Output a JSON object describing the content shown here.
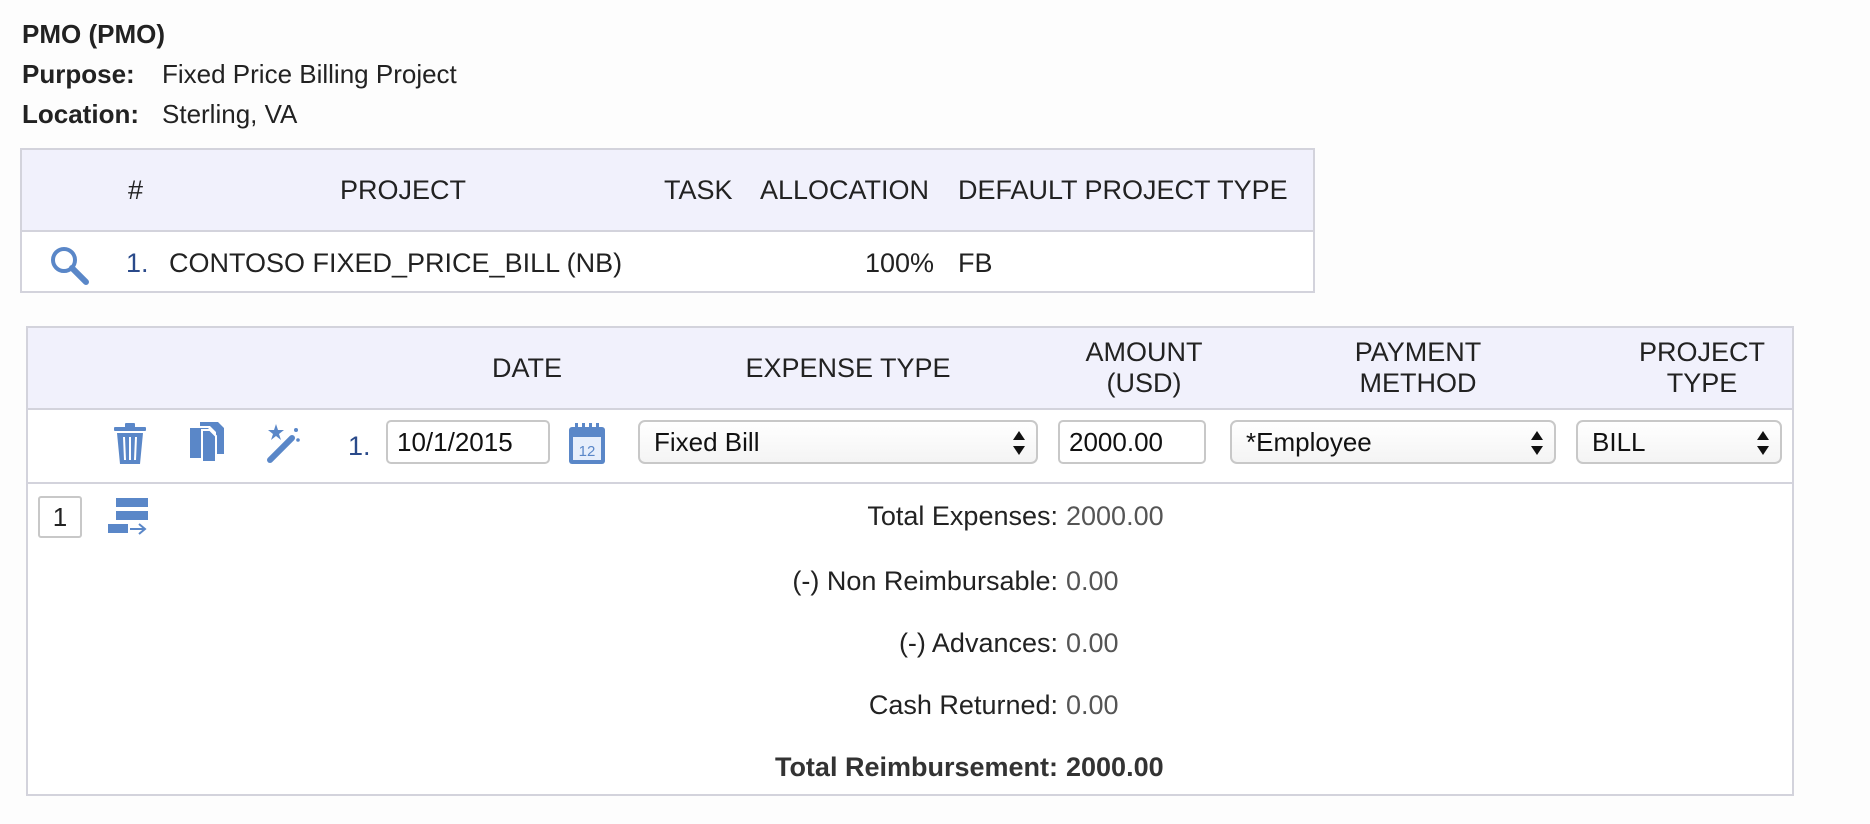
{
  "header": {
    "title": "PMO (PMO)",
    "purpose_label": "Purpose:",
    "purpose_value": "Fixed Price Billing Project",
    "location_label": "Location:",
    "location_value": "Sterling, VA"
  },
  "allocation": {
    "columns": {
      "num": "#",
      "project": "PROJECT",
      "task": "TASK",
      "allocation": "ALLOCATION",
      "default_project_type": "DEFAULT PROJECT TYPE"
    },
    "rows": [
      {
        "num": "1.",
        "project": "CONTOSO FIXED_PRICE_BILL (NB)",
        "task": "",
        "allocation": "100%",
        "default_project_type": "FB"
      }
    ]
  },
  "expenses": {
    "columns": {
      "date": "DATE",
      "expense_type": "EXPENSE TYPE",
      "amount_line1": "AMOUNT",
      "amount_line2": "(USD)",
      "payment_line1": "PAYMENT",
      "payment_line2": "METHOD",
      "ptype_line1": "PROJECT",
      "ptype_line2": "TYPE"
    },
    "rows": [
      {
        "num": "1.",
        "date": "10/1/2015",
        "expense_type": "Fixed Bill",
        "amount": "2000.00",
        "payment_method": "*Employee",
        "project_type": "BILL"
      }
    ],
    "page": "1"
  },
  "totals": {
    "total_expenses_label": "Total Expenses:",
    "total_expenses": "2000.00",
    "non_reimbursable_label": "(-) Non Reimbursable:",
    "non_reimbursable": "0.00",
    "advances_label": "(-) Advances:",
    "advances": "0.00",
    "cash_returned_label": "Cash Returned:",
    "cash_returned": "0.00",
    "total_reimbursement_label": "Total Reimbursement:",
    "total_reimbursement": "2000.00"
  },
  "colors": {
    "icon_blue": "#5a87c8",
    "header_bg": "#f1f1fc",
    "border": "#d3d3dc"
  }
}
